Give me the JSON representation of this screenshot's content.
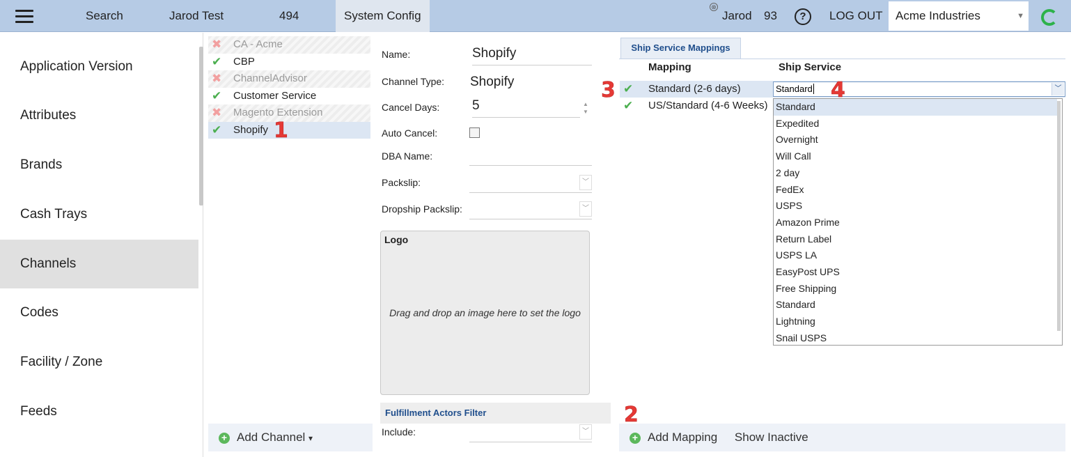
{
  "topbar": {
    "search": "Search",
    "user_test": "Jarod Test",
    "count": "494",
    "system_config": "System Config",
    "close_glyph": "⊗",
    "user": "Jarod",
    "user_count": "93",
    "help_glyph": "?",
    "logout": "LOG OUT",
    "company": "Acme Industries",
    "caret": "▼"
  },
  "sidebar": {
    "items": [
      "Application Version",
      "Attributes",
      "Brands",
      "Cash Trays",
      "Channels",
      "Codes",
      "Facility / Zone",
      "Feeds"
    ],
    "active": "Channels"
  },
  "channels": {
    "items": [
      {
        "name": "CA - Acme",
        "active": false,
        "icon": "✖"
      },
      {
        "name": "CBP",
        "active": true,
        "icon": "✔"
      },
      {
        "name": "ChannelAdvisor",
        "active": false,
        "icon": "✖"
      },
      {
        "name": "Customer Service",
        "active": true,
        "icon": "✔"
      },
      {
        "name": "Magento Extension",
        "active": false,
        "icon": "✖"
      },
      {
        "name": "Shopify",
        "active": true,
        "icon": "✔"
      }
    ],
    "selected": "Shopify",
    "add_label": "Add Channel",
    "add_caret": "▾"
  },
  "form": {
    "name_label": "Name:",
    "name_value": "Shopify",
    "type_label": "Channel Type:",
    "type_value": "Shopify",
    "cancel_days_label": "Cancel Days:",
    "cancel_days_value": "5",
    "auto_cancel_label": "Auto Cancel:",
    "dba_label": "DBA Name:",
    "packslip_label": "Packslip:",
    "dropship_label": "Dropship Packslip:",
    "logo_title": "Logo",
    "logo_hint": "Drag and drop an image here to set the logo",
    "fulfillment_header": "Fulfillment Actors Filter",
    "include_label": "Include:"
  },
  "mappings": {
    "tab": "Ship Service Mappings",
    "col_mapping": "Mapping",
    "col_service": "Ship Service",
    "rows": [
      "Standard (2-6 days)",
      "US/Standard (4-6 Weeks)"
    ],
    "check_glyph": "✔",
    "service_input": "Standard",
    "dropdown_options": [
      "Standard",
      "Expedited",
      "Overnight",
      "Will Call",
      "2 day",
      "FedEx",
      "USPS",
      "Amazon Prime",
      "Return Label",
      "USPS LA",
      "EasyPost UPS",
      "Free Shipping",
      "Standard",
      "Lightning",
      "Snail USPS"
    ],
    "add_label": "Add Mapping",
    "show_inactive": "Show Inactive"
  },
  "annotations": [
    "1",
    "2",
    "3",
    "4"
  ],
  "colors": {
    "topbar": "#b6cbe5",
    "accent": "#1f4e8c",
    "check": "#4caf50",
    "annotation": "#e53935"
  }
}
